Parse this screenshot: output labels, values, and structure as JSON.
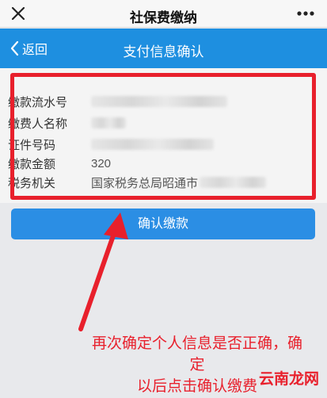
{
  "app": {
    "title": "社保费缴纳"
  },
  "nav": {
    "back_label": "返回",
    "title": "支付信息确认"
  },
  "fields": [
    {
      "label": "缴款流水号",
      "value": ""
    },
    {
      "label": "缴费人名称",
      "value": ""
    },
    {
      "label": "证件号码",
      "value": ""
    },
    {
      "label": "缴款金额",
      "value": "320"
    },
    {
      "label": "税务机关",
      "value": "国家税务总局昭通市"
    }
  ],
  "confirm_button": {
    "label": "确认缴款"
  },
  "annotation": {
    "line1": "再次确定个人信息是否正确，确定",
    "line2": "以后点击确认缴费"
  },
  "watermark": {
    "text": "云南龙网"
  },
  "colors": {
    "nav_blue": "#1e8fe0",
    "button_blue": "#2b8ee4",
    "annotation_red": "#e8202c"
  }
}
